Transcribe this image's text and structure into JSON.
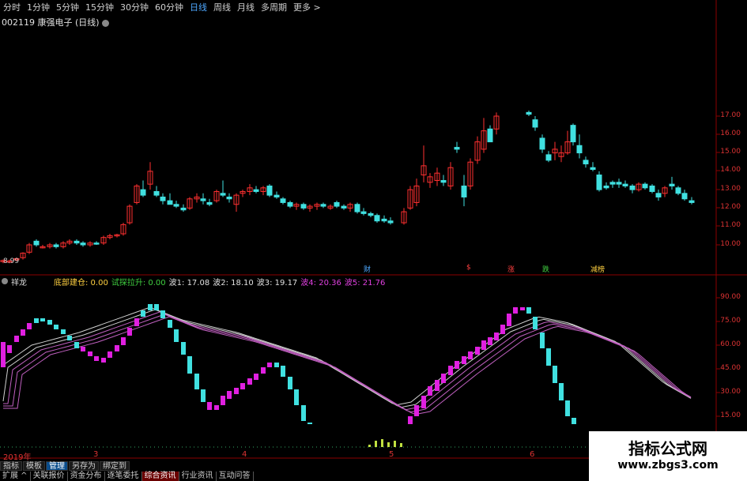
{
  "toolbar": {
    "periods": [
      "分时",
      "1分钟",
      "5分钟",
      "15分钟",
      "30分钟",
      "60分钟",
      "日线",
      "周线",
      "月线",
      "多周期",
      "更多 >"
    ],
    "active_period": "日线"
  },
  "stock": {
    "title": "002119 康强电子 (日线)"
  },
  "price_axis": {
    "labels": [
      "17.00",
      "16.00",
      "15.00",
      "14.00",
      "13.00",
      "12.00",
      "11.00",
      "10.00"
    ],
    "low_label": "8.99"
  },
  "events": [
    {
      "label": "财",
      "color": "#4ea8ff"
    },
    {
      "label": "$",
      "color": "#ff4040"
    },
    {
      "label": "涨",
      "color": "#ff4040"
    },
    {
      "label": "跌",
      "color": "#40d040"
    },
    {
      "label": "减榜",
      "color": "#ffd040"
    }
  ],
  "indicator": {
    "name": "祥龙",
    "fields": [
      {
        "text": "底部建仓: 0.00",
        "color": "#ffd040"
      },
      {
        "text": "试探拉升: 0.00",
        "color": "#40d040"
      },
      {
        "text": "波1: 17.08",
        "color": "#e0e0e0"
      },
      {
        "text": "波2: 18.10",
        "color": "#e0e0e0"
      },
      {
        "text": "波3: 19.17",
        "color": "#e0e0e0"
      },
      {
        "text": "波4: 20.36",
        "color": "#e040e0"
      },
      {
        "text": "波5: 21.76",
        "color": "#e040e0"
      }
    ],
    "axis_labels": [
      "90.00",
      "75.00",
      "60.00",
      "45.00",
      "30.00",
      "15.00"
    ]
  },
  "time_axis": {
    "labels": [
      "2019年",
      "3",
      "4",
      "5",
      "6"
    ]
  },
  "bottom_tabs_1": [
    "指标",
    "模板",
    "管理",
    "另存为",
    "绑定到"
  ],
  "bottom_tabs_1_active": "管理",
  "bottom_tabs_2": [
    "扩展 ^",
    "关联报价",
    "资金分布",
    "逐笔委托",
    "综合资讯",
    "行业资讯",
    "互动问答"
  ],
  "bottom_tabs_2_highlight": [
    "综合资讯"
  ],
  "watermark": {
    "title": "指标公式网",
    "url": "www.zbgs3.com"
  },
  "colors": {
    "up": "#ff3030",
    "down": "#40e0e0",
    "axis_line": "#8b0000",
    "accent": "#4ea8ff"
  }
}
